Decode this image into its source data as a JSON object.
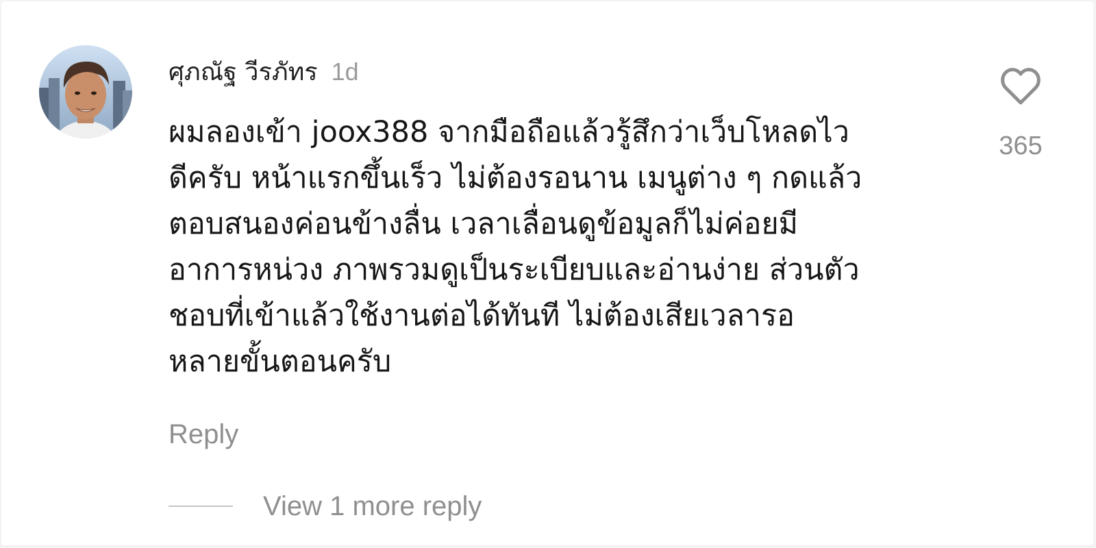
{
  "comment": {
    "author_name": "ศุภณัฐ วีรภัทร",
    "timestamp": "1d",
    "body": "ผมลองเข้า joox388 จากมือถือแล้วรู้สึกว่าเว็บโหลดไว\nดีครับ หน้าแรกขึ้นเร็ว ไม่ต้องรอนาน เมนูต่าง ๆ กดแล้ว\nตอบสนองค่อนข้างลื่น เวลาเลื่อนดูข้อมูลก็ไม่ค่อยมี\nอาการหน่วง ภาพรวมดูเป็นระเบียบและอ่านง่าย ส่วนตัว\nชอบที่เข้าแล้วใช้งานต่อได้ทันที ไม่ต้องเสียเวลารอ\nหลายขั้นตอนครับ",
    "like_count": "365",
    "reply_label": "Reply",
    "view_replies_label": "View 1 more reply",
    "like_icon": "heart-outline-icon"
  },
  "colors": {
    "author": "#222222",
    "body": "#161616",
    "muted": "#8f8f8f",
    "heart_stroke": "#8f8f8f",
    "background": "#ffffff"
  }
}
